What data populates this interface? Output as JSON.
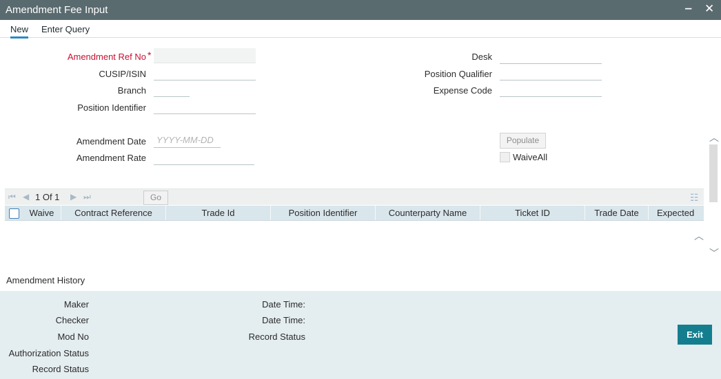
{
  "window": {
    "title": "Amendment Fee Input",
    "minimize_glyph": "‒",
    "close_glyph": "✕"
  },
  "toolbar": {
    "new_label": "New",
    "enter_query_label": "Enter Query"
  },
  "form": {
    "amendment_ref_no_label": "Amendment Ref No",
    "required_mark": "*",
    "cusip_isin_label": "CUSIP/ISIN",
    "branch_label": "Branch",
    "position_identifier_label": "Position Identifier",
    "desk_label": "Desk",
    "position_qualifier_label": "Position Qualifier",
    "expense_code_label": "Expense Code",
    "amendment_date_label": "Amendment Date",
    "amendment_date_placeholder": "YYYY-MM-DD",
    "amendment_rate_label": "Amendment Rate",
    "populate_label": "Populate",
    "waive_all_label": "WaiveAll"
  },
  "grid": {
    "page_text": "1 Of 1",
    "go_label": "Go",
    "columns": [
      "Waive",
      "Contract Reference",
      "Trade Id",
      "Position Identifier",
      "Counterparty Name",
      "Ticket ID",
      "Trade Date",
      "Expected"
    ]
  },
  "history": {
    "title": "Amendment History",
    "maker_label": "Maker",
    "checker_label": "Checker",
    "mod_no_label": "Mod No",
    "authorization_status_label": "Authorization Status",
    "record_status_label": "Record Status",
    "date_time_label_1": "Date Time:",
    "date_time_label_2": "Date Time:",
    "record_status_label_2": "Record Status"
  },
  "exit_label": "Exit",
  "colors": {
    "titlebar": "#5a6b70",
    "accent": "#2b8ac6",
    "exit_button": "#147e8f",
    "history_bg": "#e4edef",
    "grid_header": "#d9e6ec",
    "required": "#c8102e"
  }
}
